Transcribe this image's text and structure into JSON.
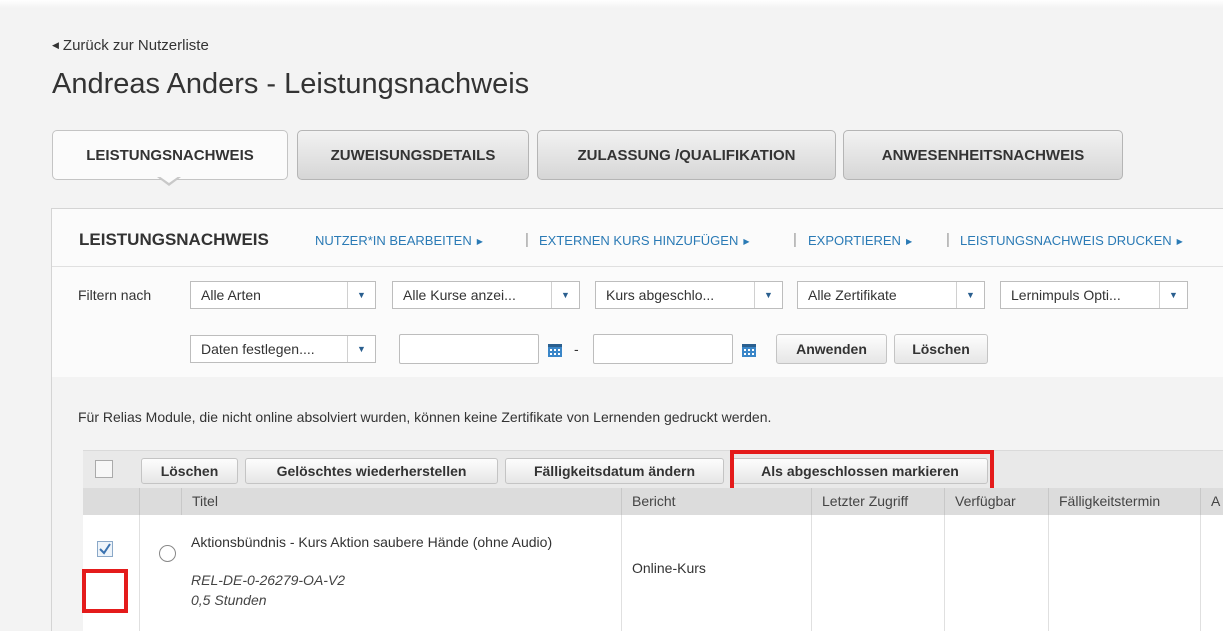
{
  "header": {
    "back_link": "Zurück zur Nutzerliste",
    "title": "Andreas Anders - Leistungsnachweis"
  },
  "tabs": [
    {
      "label": "LEISTUNGSNACHWEIS",
      "active": true
    },
    {
      "label": "ZUWEISUNGSDETAILS",
      "active": false
    },
    {
      "label": "ZULASSUNG /QUALIFIKATION",
      "active": false
    },
    {
      "label": "ANWESENHEITSNACHWEIS",
      "active": false
    }
  ],
  "panel": {
    "title": "LEISTUNGSNACHWEIS",
    "links": [
      "NUTZER*IN BEARBEITEN",
      "EXTERNEN KURS HINZUFÜGEN",
      "EXPORTIEREN",
      "LEISTUNGSNACHWEIS DRUCKEN"
    ]
  },
  "filters": {
    "label": "Filtern nach",
    "selects": [
      "Alle Arten",
      "Alle Kurse anzei...",
      "Kurs abgeschlo...",
      "Alle Zertifikate",
      "Lernimpuls Opti..."
    ],
    "date_select": "Daten festlegen....",
    "date_from": "",
    "date_to": "",
    "dash": "-",
    "apply_label": "Anwenden",
    "clear_label": "Löschen"
  },
  "notice": "Für Relias Module, die nicht online absolviert wurden, können keine Zertifikate von Lernenden gedruckt werden.",
  "toolbar": {
    "delete_label": "Löschen",
    "restore_label": "Gelöschtes wiederherstellen",
    "due_date_label": "Fälligkeitsdatum ändern",
    "mark_complete_label": "Als abgeschlossen markieren"
  },
  "grid": {
    "columns": [
      "Titel",
      "Bericht",
      "Letzter Zugriff",
      "Verfügbar",
      "Fälligkeitstermin",
      "A"
    ],
    "rows": [
      {
        "title": "Aktionsbündnis - Kurs Aktion saubere Hände (ohne Audio)",
        "code": "REL-DE-0-26279-OA-V2",
        "hours": "0,5 Stunden",
        "report": "Online-Kurs",
        "last_access": "",
        "available": "",
        "due": "",
        "checked": true
      }
    ]
  },
  "colors": {
    "link": "#2a7ab5",
    "highlight": "#e41b1b"
  }
}
